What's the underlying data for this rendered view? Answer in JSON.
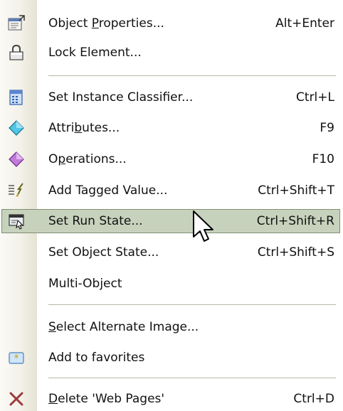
{
  "menu": {
    "items": [
      {
        "label_parts": [
          "Object ",
          "P",
          "roperties..."
        ],
        "shortcut": "Alt+Enter",
        "icon": "object-properties-icon"
      },
      {
        "label_parts": [
          "Lock Element...",
          "",
          ""
        ],
        "shortcut": "",
        "icon": "lock-icon"
      },
      {
        "label_parts": [
          "Set Instance Classifier...",
          "",
          ""
        ],
        "shortcut": "Ctrl+L",
        "icon": "classifier-icon"
      },
      {
        "label_parts": [
          "Attri",
          "b",
          "utes..."
        ],
        "shortcut": "F9",
        "icon": "attributes-icon"
      },
      {
        "label_parts": [
          "O",
          "p",
          "erations..."
        ],
        "shortcut": "F10",
        "icon": "operations-icon"
      },
      {
        "label_parts": [
          "Add Tagged Value...",
          "",
          ""
        ],
        "shortcut": "Ctrl+Shift+T",
        "icon": "tagged-value-icon"
      },
      {
        "label_parts": [
          "Set Run State...",
          "",
          ""
        ],
        "shortcut": "Ctrl+Shift+R",
        "icon": "run-state-icon"
      },
      {
        "label_parts": [
          "Set Object State...",
          "",
          ""
        ],
        "shortcut": "Ctrl+Shift+S",
        "icon": ""
      },
      {
        "label_parts": [
          "Multi-Object",
          "",
          ""
        ],
        "shortcut": "",
        "icon": ""
      },
      {
        "label_parts": [
          "",
          "S",
          "elect Alternate Image..."
        ],
        "shortcut": "",
        "icon": ""
      },
      {
        "label_parts": [
          "Add to favorites",
          "",
          ""
        ],
        "shortcut": "",
        "icon": "favorites-icon"
      },
      {
        "label_parts": [
          "",
          "D",
          "elete 'Web Pages'"
        ],
        "shortcut": "Ctrl+D",
        "icon": "delete-icon"
      }
    ],
    "highlighted_item": "Set Run State...",
    "colors": {
      "highlight_fill": "#c7d2bd",
      "highlight_border": "#7f8f74",
      "delete_icon": "#9b3a3a"
    }
  }
}
